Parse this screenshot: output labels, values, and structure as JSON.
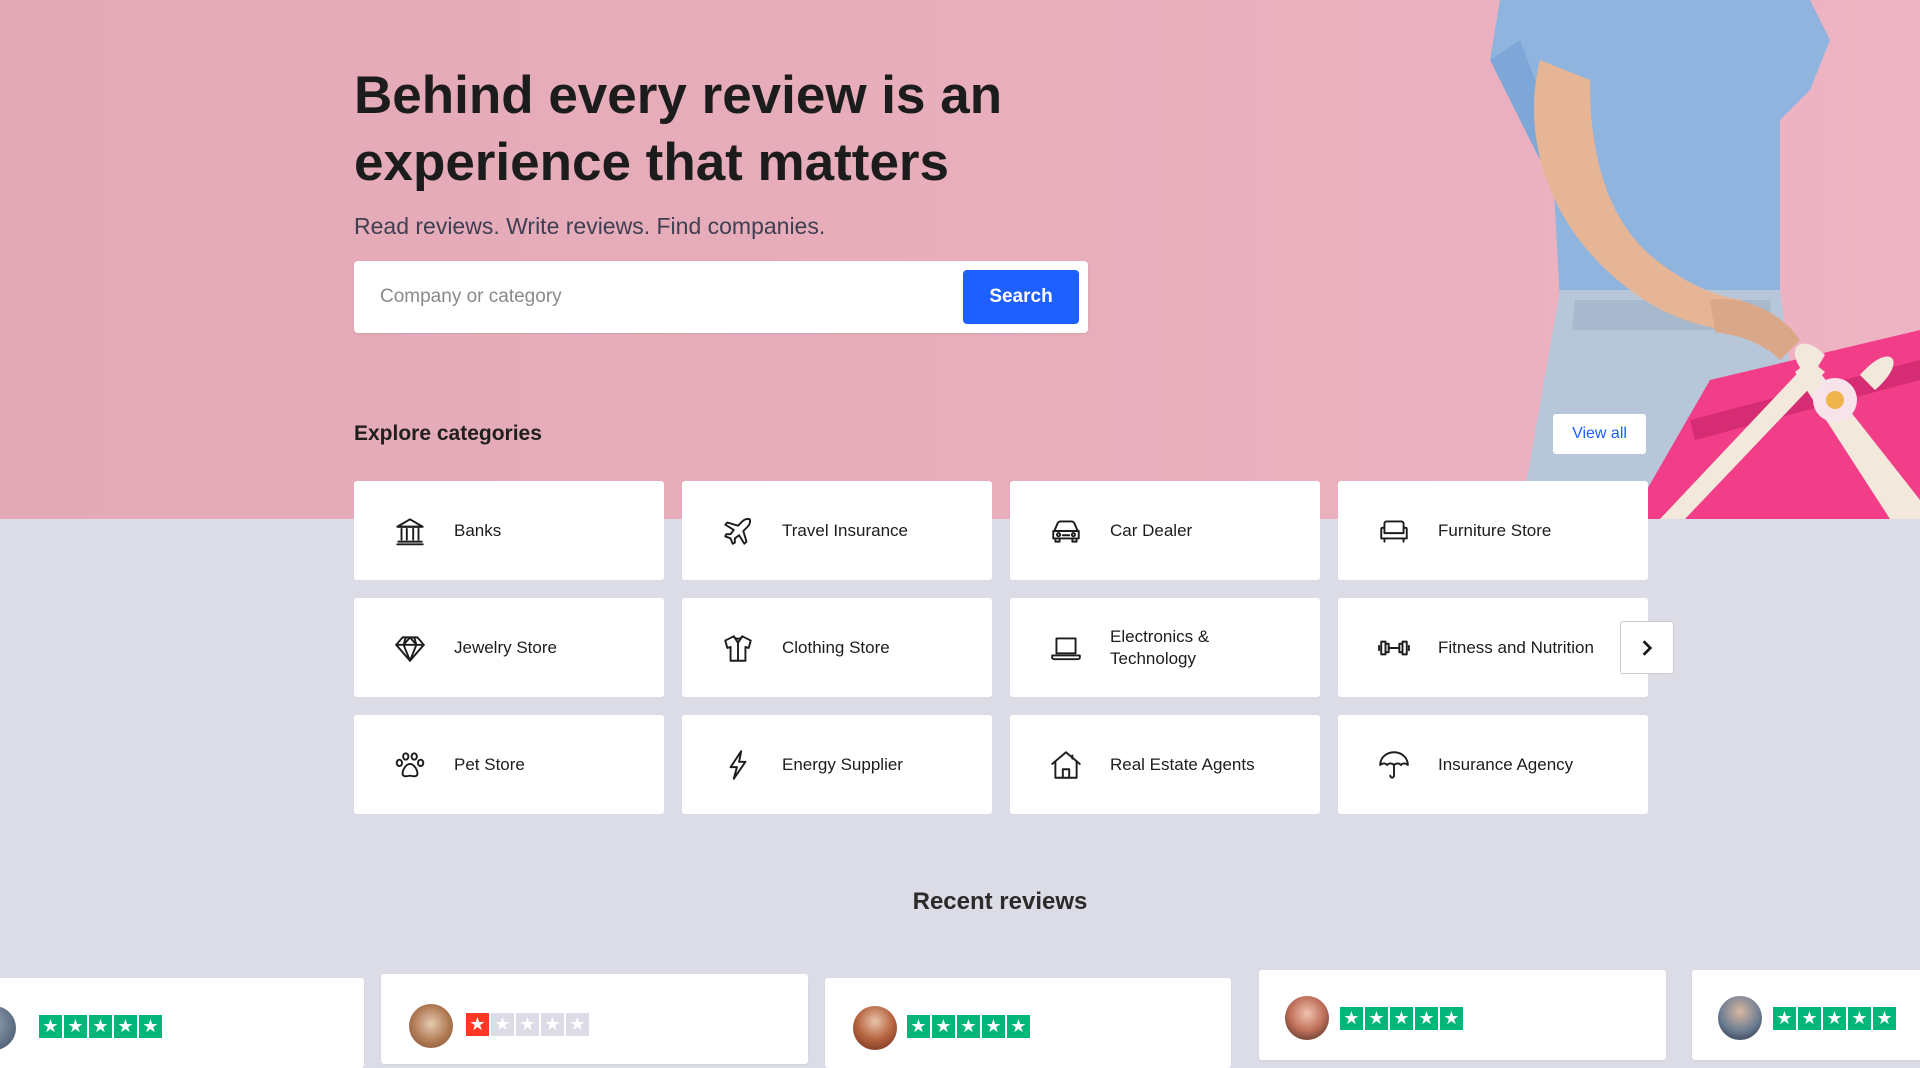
{
  "hero": {
    "headline": "Behind every review is an experience that matters",
    "subline": "Read reviews. Write reviews. Find companies."
  },
  "search": {
    "placeholder": "Company or category",
    "value": "",
    "button_label": "Search"
  },
  "categories": {
    "title": "Explore categories",
    "view_all_label": "View all",
    "items": [
      {
        "label": "Banks",
        "icon": "bank-icon"
      },
      {
        "label": "Travel Insurance",
        "icon": "airplane-icon"
      },
      {
        "label": "Car Dealer",
        "icon": "car-icon"
      },
      {
        "label": "Furniture Store",
        "icon": "sofa-icon"
      },
      {
        "label": "Jewelry Store",
        "icon": "diamond-icon"
      },
      {
        "label": "Clothing Store",
        "icon": "shirt-icon"
      },
      {
        "label": "Electronics & Technology",
        "icon": "laptop-icon"
      },
      {
        "label": "Fitness and Nutrition",
        "icon": "dumbbell-icon"
      },
      {
        "label": "Pet Store",
        "icon": "paw-icon"
      },
      {
        "label": "Energy Supplier",
        "icon": "lightning-icon"
      },
      {
        "label": "Real Estate Agents",
        "icon": "house-icon"
      },
      {
        "label": "Insurance Agency",
        "icon": "umbrella-icon"
      }
    ]
  },
  "recent_reviews": {
    "title": "Recent reviews",
    "cards": [
      {
        "rating": 5
      },
      {
        "rating": 1
      },
      {
        "rating": 5
      },
      {
        "rating": 5
      },
      {
        "rating": 5
      }
    ]
  },
  "colors": {
    "brand_blue": "#1d5fff",
    "star_green": "#00b67a",
    "star_red": "#ff3722",
    "hero_pink": "#e8aebc",
    "page_bg": "#dcdce6"
  }
}
